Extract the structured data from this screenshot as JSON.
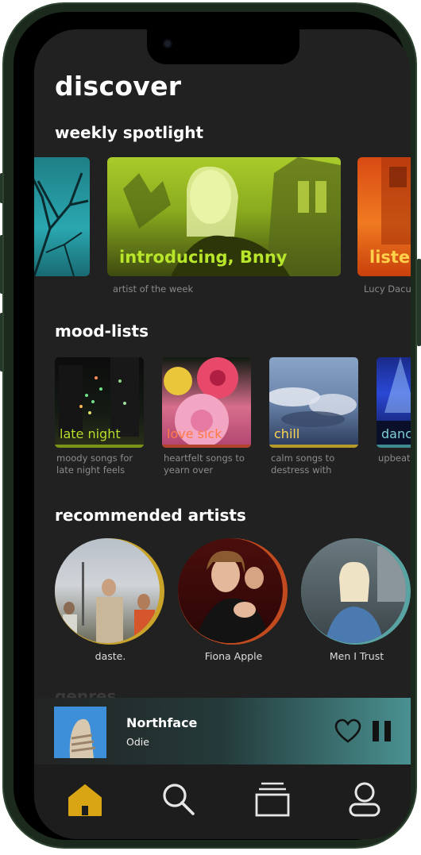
{
  "page": {
    "title": "discover"
  },
  "spotlight": {
    "title": "weekly spotlight",
    "cards": [
      {
        "label": "",
        "caption": ""
      },
      {
        "label": "introducing, Bnny",
        "caption": "artist of the week"
      },
      {
        "label": "listen",
        "caption": "Lucy Dacus"
      }
    ]
  },
  "moods": {
    "title": "mood-lists",
    "items": [
      {
        "label": "late night",
        "desc": "moody songs for late night feels",
        "color": "#b7df2c"
      },
      {
        "label": "love sick",
        "desc": "heartfelt songs to yearn over",
        "color": "#ff7a45"
      },
      {
        "label": "chill",
        "desc": "calm songs to destress with",
        "color": "#ffd451"
      },
      {
        "label": "dance",
        "desc": "upbeat songs to groove to",
        "color": "#7fd0d4"
      }
    ]
  },
  "artists": {
    "title": "recommended artists",
    "items": [
      {
        "name": "daste.",
        "ring": "#c9a32a"
      },
      {
        "name": "Fiona Apple",
        "ring": "#c24a1f"
      },
      {
        "name": "Men I Trust",
        "ring": "#5aa3a3"
      }
    ]
  },
  "genres": {
    "title": "genres"
  },
  "now_playing": {
    "track": "Northface",
    "artist": "Odie"
  },
  "nav": {
    "active_color": "#d9a514",
    "icons": [
      "home-icon",
      "search-icon",
      "library-icon",
      "profile-icon"
    ]
  }
}
